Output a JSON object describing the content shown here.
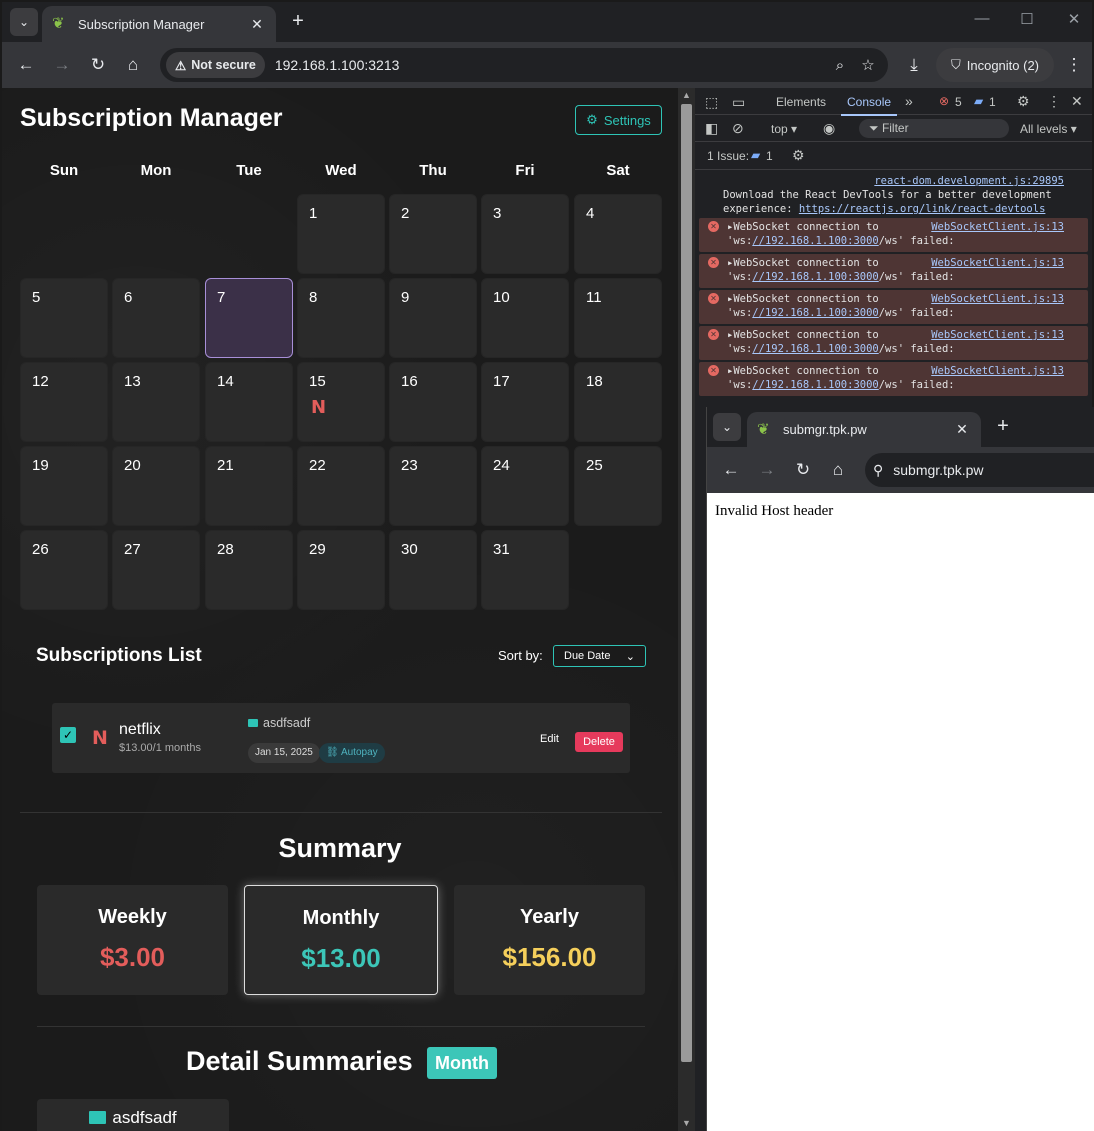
{
  "browser": {
    "tab_title": "Subscription Manager",
    "security_label": "Not secure",
    "url": "192.168.1.100:3213",
    "incognito_label": "Incognito (2)"
  },
  "app": {
    "title": "Subscription Manager",
    "settings_label": "Settings"
  },
  "calendar": {
    "weekdays": [
      "Sun",
      "Mon",
      "Tue",
      "Wed",
      "Thu",
      "Fri",
      "Sat"
    ],
    "days": [
      "1",
      "2",
      "3",
      "4",
      "5",
      "6",
      "7",
      "8",
      "9",
      "10",
      "11",
      "12",
      "13",
      "14",
      "15",
      "16",
      "17",
      "18",
      "19",
      "20",
      "21",
      "22",
      "23",
      "24",
      "25",
      "26",
      "27",
      "28",
      "29",
      "30",
      "31"
    ],
    "today": "7",
    "marked_day": "15",
    "marked_glyph": "N"
  },
  "subscriptions": {
    "title": "Subscriptions List",
    "sort_label": "Sort by:",
    "sort_value": "Due Date",
    "items": [
      {
        "logo": "N",
        "name": "netflix",
        "price": "$13.00/1 months",
        "account": "asdfsadf",
        "date": "Jan 15, 2025",
        "autopay": "Autopay",
        "edit_label": "Edit",
        "delete_label": "Delete"
      }
    ]
  },
  "summary": {
    "title": "Summary",
    "cards": [
      {
        "label": "Weekly",
        "value": "$3.00",
        "color": "#e35d5b"
      },
      {
        "label": "Monthly",
        "value": "$13.00",
        "color": "#3cc6b8"
      },
      {
        "label": "Yearly",
        "value": "$156.00",
        "color": "#f5cf5b"
      }
    ]
  },
  "detail": {
    "title": "Detail Summaries",
    "period": "Month",
    "account": "asdfsadf"
  },
  "devtools": {
    "tabs": [
      "Elements",
      "Console"
    ],
    "error_count": "5",
    "message_count": "1",
    "context": "top",
    "filter_placeholder": "Filter",
    "levels": "All levels",
    "issues_label": "1 Issue:",
    "issues_count": "1",
    "info_source": "react-dom.development.js:29895",
    "info_text": "Download the React DevTools for a better development experience: ",
    "info_link": "https://reactjs.org/link/react-devtools",
    "error_text": "WebSocket connection to",
    "error_prefix": "'ws:",
    "error_url": "//192.168.1.100:3000",
    "error_suffix": "/ws' failed:",
    "error_source": "WebSocketClient.js:13"
  },
  "inner_browser": {
    "tab_title": "submgr.tpk.pw",
    "url": "submgr.tpk.pw",
    "body_text": "Invalid Host header"
  }
}
